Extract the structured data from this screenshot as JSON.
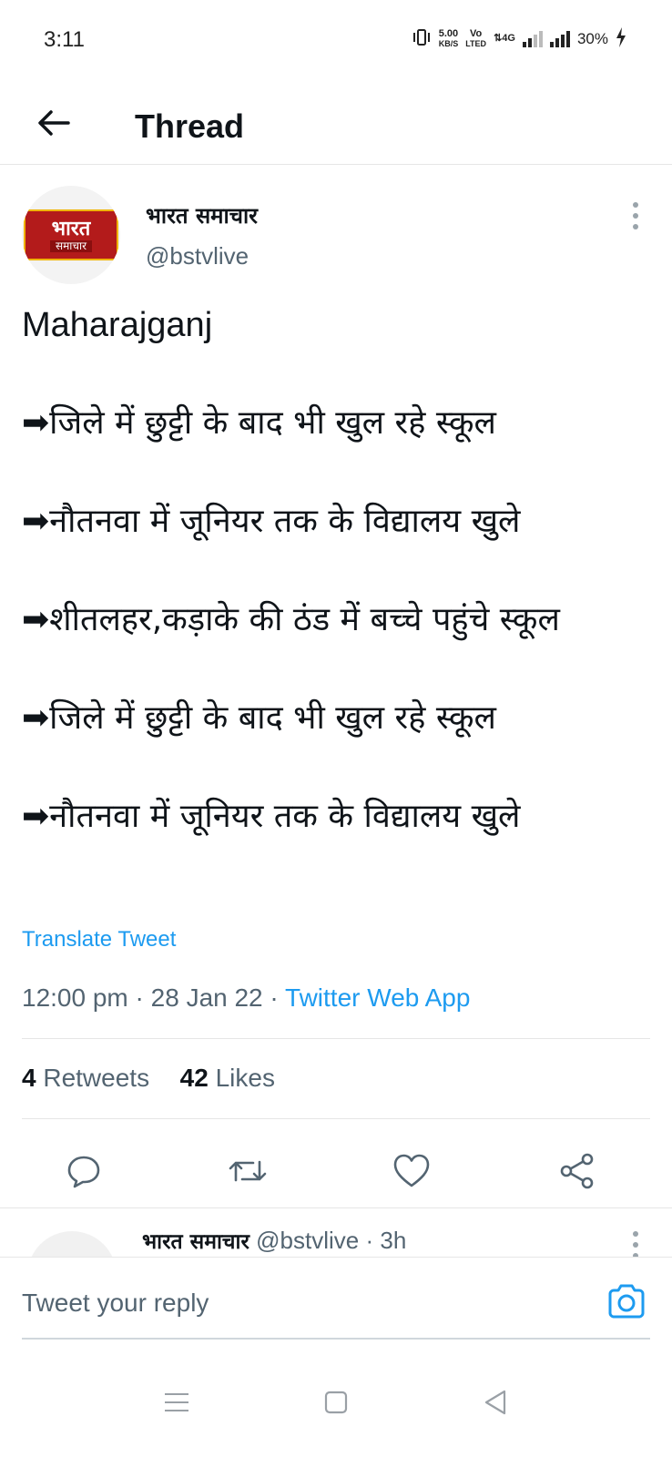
{
  "status_bar": {
    "time": "3:11",
    "speed_value": "5.00",
    "speed_unit": "KB/S",
    "volte_top": "Vo",
    "volte_bottom": "LTED",
    "network": "4G",
    "battery": "30%"
  },
  "header": {
    "back_icon": "arrow-left-icon",
    "title": "Thread"
  },
  "tweet": {
    "logo_line1": "भारत",
    "logo_line2": "समाचार",
    "author_name": "भारत समाचार",
    "author_handle": "@bstvlive",
    "lines": [
      "Maharajganj",
      "➡जिले में छुट्टी के बाद भी खुल रहे स्कूल",
      "➡नौतनवा में जूनियर तक के विद्यालय खुले",
      "➡शीतलहर,कड़ाके की ठंड में बच्चे पहुंचे स्कूल",
      "➡जिले में छुट्टी के बाद भी खुल रहे स्कूल",
      "➡नौतनवा में जूनियर तक के विद्यालय खुले"
    ],
    "translate_label": "Translate Tweet",
    "time": "12:00 pm",
    "date": "28 Jan 22",
    "source": "Twitter Web App",
    "separator": "·",
    "retweets_count": "4",
    "retweets_label": "Retweets",
    "likes_count": "42",
    "likes_label": "Likes"
  },
  "actions": {
    "reply_icon": "reply-icon",
    "retweet_icon": "retweet-icon",
    "like_icon": "heart-icon",
    "share_icon": "share-icon"
  },
  "next_tweet": {
    "author_name": "भारत समाचार",
    "author_handle": "@bstvlive",
    "separator": "·",
    "time_ago": "3h"
  },
  "reply_bar": {
    "placeholder": "Tweet your reply",
    "camera_icon": "camera-icon"
  },
  "nav_bar": {
    "menu_icon": "menu-icon",
    "home_icon": "square-home-icon",
    "back_icon": "triangle-back-icon"
  },
  "colors": {
    "accent": "#1d9bf0",
    "secondary_text": "#536471",
    "primary_text": "#0f1419",
    "divider": "#e6e6e6",
    "logo_red": "#b31b1b"
  }
}
